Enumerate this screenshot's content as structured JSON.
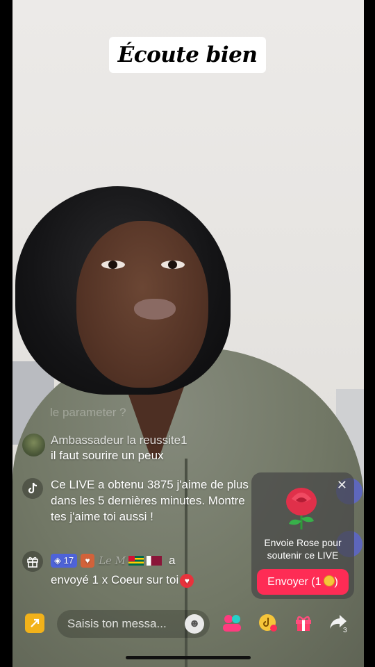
{
  "title_caption": "Écoute bien",
  "faded_comment": "le parameter ?",
  "comment": {
    "username": "Ambassadeur la reussite1",
    "message": "il faut sourire un peux"
  },
  "system_message": "Ce LIVE a obtenu 3875 j'aime de plus dans les 5 dernières minutes. Montre tes j'aime toi aussi !",
  "gift_notice": {
    "level": "17",
    "user_deco": "Le M",
    "suffix": "a",
    "text": "envoyé 1 x Coeur sur toi"
  },
  "rose_card": {
    "text": "Envoie Rose pour soutenir ce LIVE",
    "button_label": "Envoyer (1",
    "close": "✕"
  },
  "bottom_bar": {
    "input_placeholder": "Saisis ton messa...",
    "share_count": "3"
  },
  "colors": {
    "accent": "#fe2c55",
    "level_badge": "#4e63d8"
  }
}
